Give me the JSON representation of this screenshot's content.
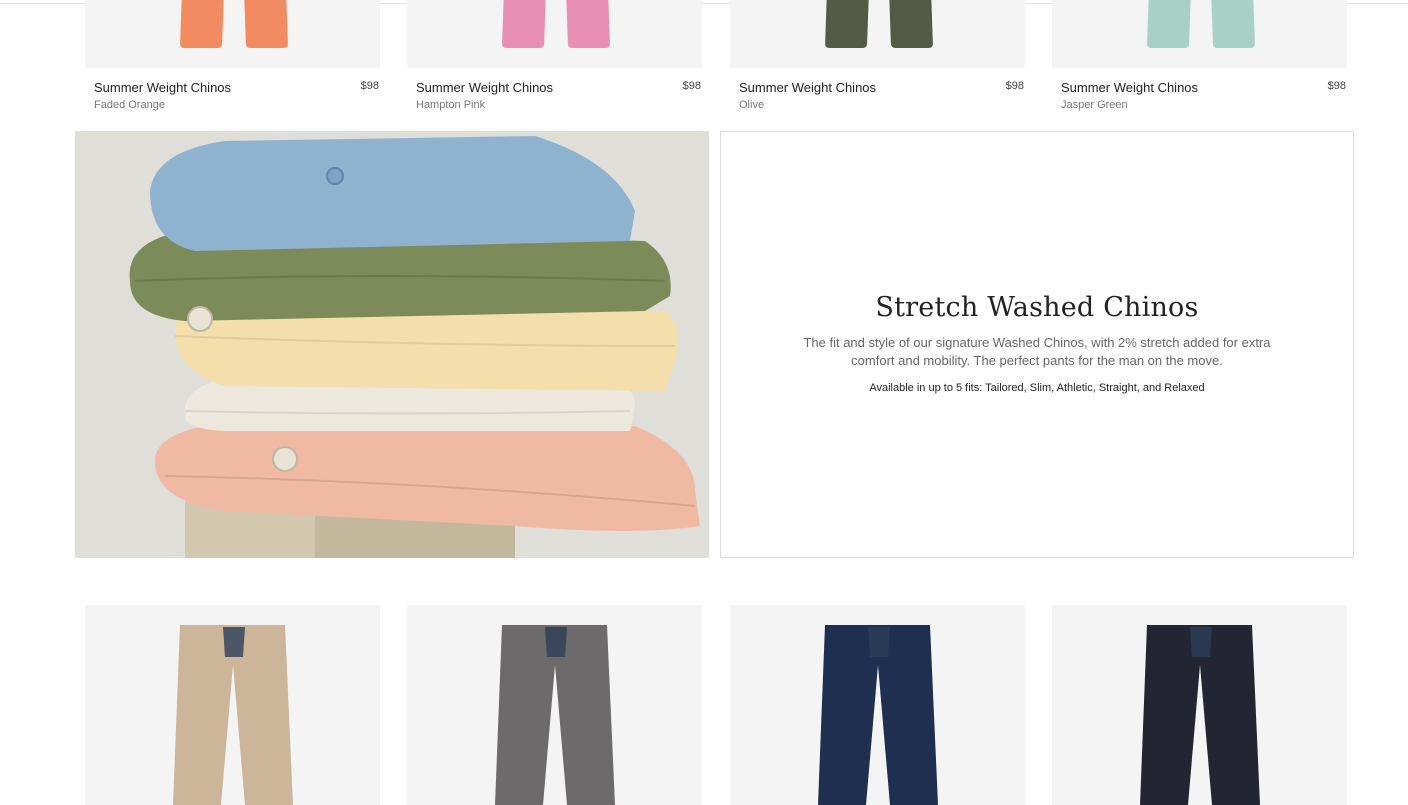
{
  "top_products": [
    {
      "name": "Summer Weight Chinos",
      "color": "Faded Orange",
      "price": "$98",
      "swatch": "#f28a62"
    },
    {
      "name": "Summer Weight Chinos",
      "color": "Hampton Pink",
      "price": "$98",
      "swatch": "#e98fb4"
    },
    {
      "name": "Summer Weight Chinos",
      "color": "Olive",
      "price": "$98",
      "swatch": "#545b45"
    },
    {
      "name": "Summer Weight Chinos",
      "color": "Jasper Green",
      "price": "$98",
      "swatch": "#a8d0c7"
    }
  ],
  "hero": {
    "title": "Stretch Washed Chinos",
    "description": "The fit and style of our signature Washed Chinos, with 2% stretch added for extra comfort and mobility. The perfect pants for the man on the move.",
    "fits": "Available in up to 5 fits: Tailored, Slim, Athletic, Straight, and Relaxed",
    "image_icon": "folded-chinos-stack-photo",
    "fold_colors": [
      "#8fb2cf",
      "#7d8a5a",
      "#f3deac",
      "#ece8de",
      "#f0b9a4"
    ]
  },
  "bottom_products": [
    {
      "color": "#cdb59a",
      "icon": "khaki-chinos-image"
    },
    {
      "color": "#6d6a6b",
      "icon": "grey-chinos-image"
    },
    {
      "color": "#1f2f4f",
      "icon": "navy-chinos-image"
    },
    {
      "color": "#232533",
      "icon": "black-chinos-image"
    }
  ]
}
